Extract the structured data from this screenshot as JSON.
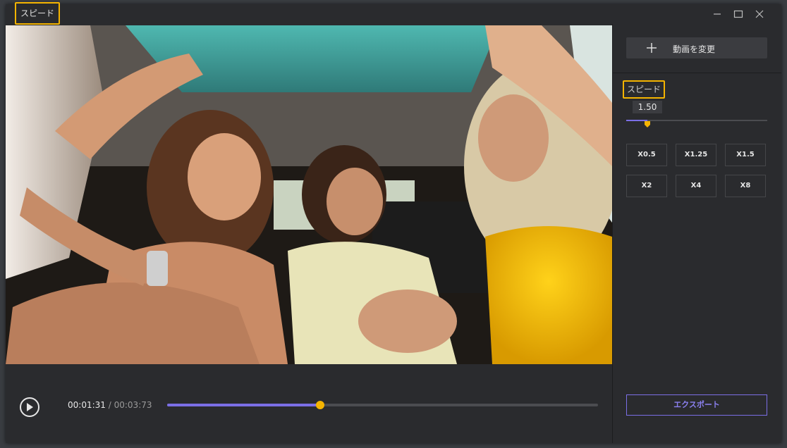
{
  "window": {
    "title": "スピード"
  },
  "player": {
    "current_time": "00:01:31",
    "separator": "/",
    "total_time": "00:03:73",
    "progress": 0.355,
    "accent_color": "#7b6fe6",
    "thumb_color": "#f5b400"
  },
  "panel": {
    "change_video_label": "動画を変更",
    "speed_label": "スピード",
    "speed_value": "1.50",
    "speed_fraction": 0.15,
    "presets": [
      "X0.5",
      "X1.25",
      "X1.5",
      "X2",
      "X4",
      "X8"
    ],
    "export_label": "エクスポート"
  },
  "icons": {
    "minimize": "minimize-icon",
    "maximize": "maximize-icon",
    "close": "close-icon",
    "play": "play-icon",
    "plus": "plus-icon"
  }
}
